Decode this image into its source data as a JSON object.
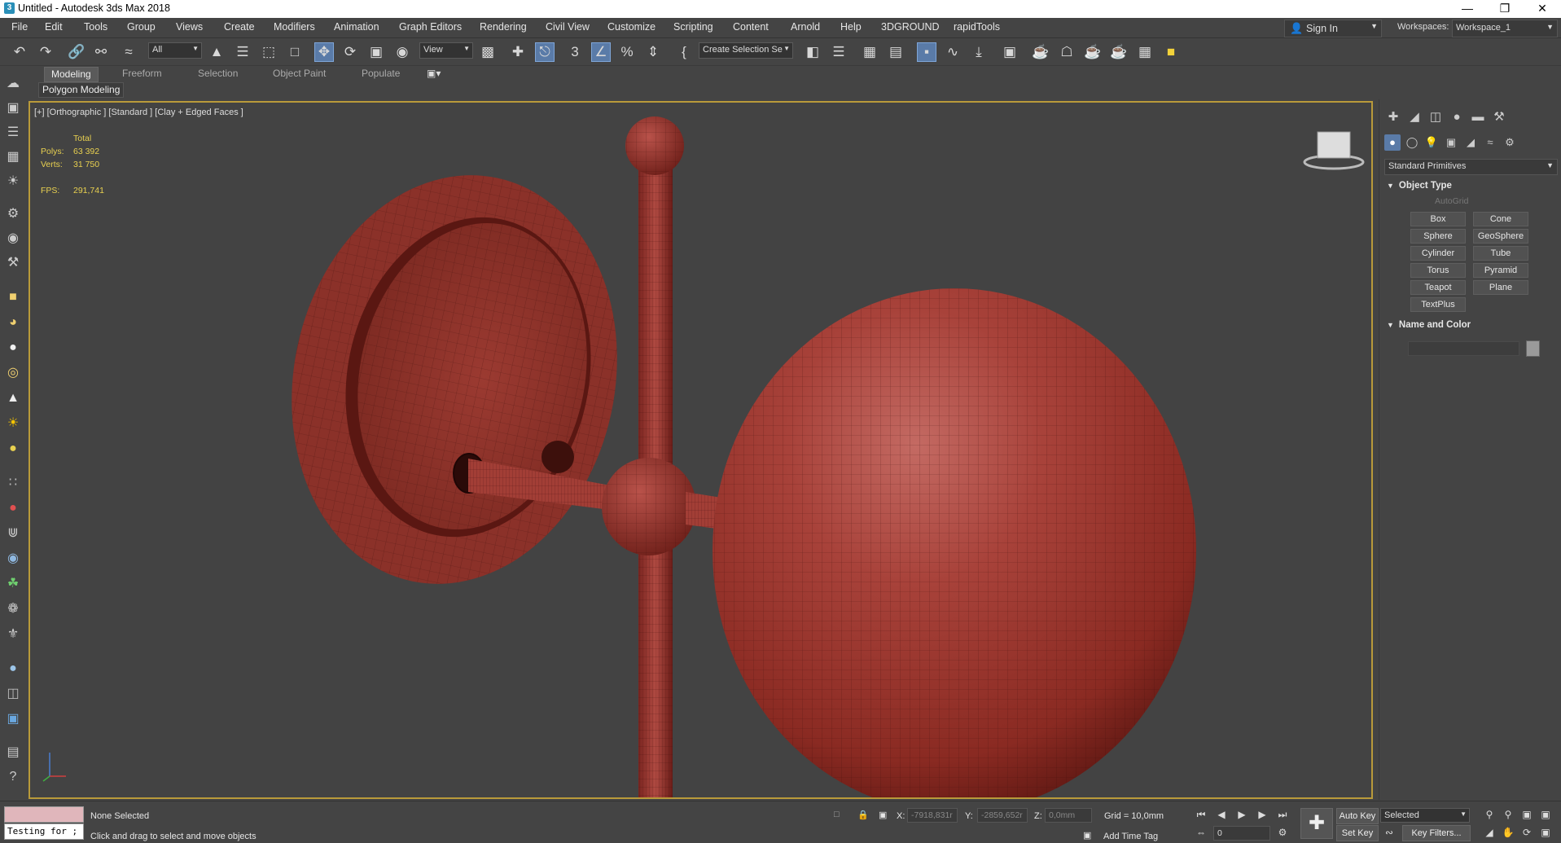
{
  "window": {
    "title": "Untitled - Autodesk 3ds Max 2018",
    "app_icon_text": "3"
  },
  "menu": [
    "File",
    "Edit",
    "Tools",
    "Group",
    "Views",
    "Create",
    "Modifiers",
    "Animation",
    "Graph Editors",
    "Rendering",
    "Civil View",
    "Customize",
    "Scripting",
    "Content",
    "Arnold",
    "Help",
    "3DGROUND",
    "rapidTools"
  ],
  "account": {
    "sign_in": "Sign In",
    "workspaces_label": "Workspaces:",
    "workspace_value": "Workspace_1"
  },
  "toolbar": {
    "selection_filter": "All",
    "ref_coord": "View",
    "named_selection": "Create Selection Se"
  },
  "ribbon": {
    "tabs": [
      "Modeling",
      "Freeform",
      "Selection",
      "Object Paint",
      "Populate"
    ],
    "active_tab": "Modeling",
    "panel_label": "Polygon Modeling"
  },
  "viewport": {
    "label": "[+] [Orthographic ] [Standard ] [Clay + Edged Faces ]",
    "stats": {
      "total_label": "Total",
      "polys_label": "Polys:",
      "polys_value": "63 392",
      "verts_label": "Verts:",
      "verts_value": "31 750",
      "fps_label": "FPS:",
      "fps_value": "291,741"
    },
    "model_color": "#a8352b"
  },
  "command_panel": {
    "category": "Standard Primitives",
    "object_type_header": "Object Type",
    "autogrid_label": "AutoGrid",
    "object_buttons": [
      "Box",
      "Cone",
      "Sphere",
      "GeoSphere",
      "Cylinder",
      "Tube",
      "Torus",
      "Pyramid",
      "Teapot",
      "Plane",
      "TextPlus"
    ],
    "name_color_header": "Name and Color"
  },
  "status": {
    "maxscript_text": "Testing for ;",
    "selection_status": "None Selected",
    "prompt": "Click and drag to select and move objects",
    "x_label": "X:",
    "x_value": "-7918,831r",
    "y_label": "Y:",
    "y_value": "-2859,652r",
    "z_label": "Z:",
    "z_value": "0,0mm",
    "grid": "Grid = 10,0mm",
    "add_time_tag": "Add Time Tag",
    "frame": "0",
    "auto_key": "Auto Key",
    "set_key": "Set Key",
    "key_mode": "Selected",
    "key_filters": "Key Filters..."
  }
}
